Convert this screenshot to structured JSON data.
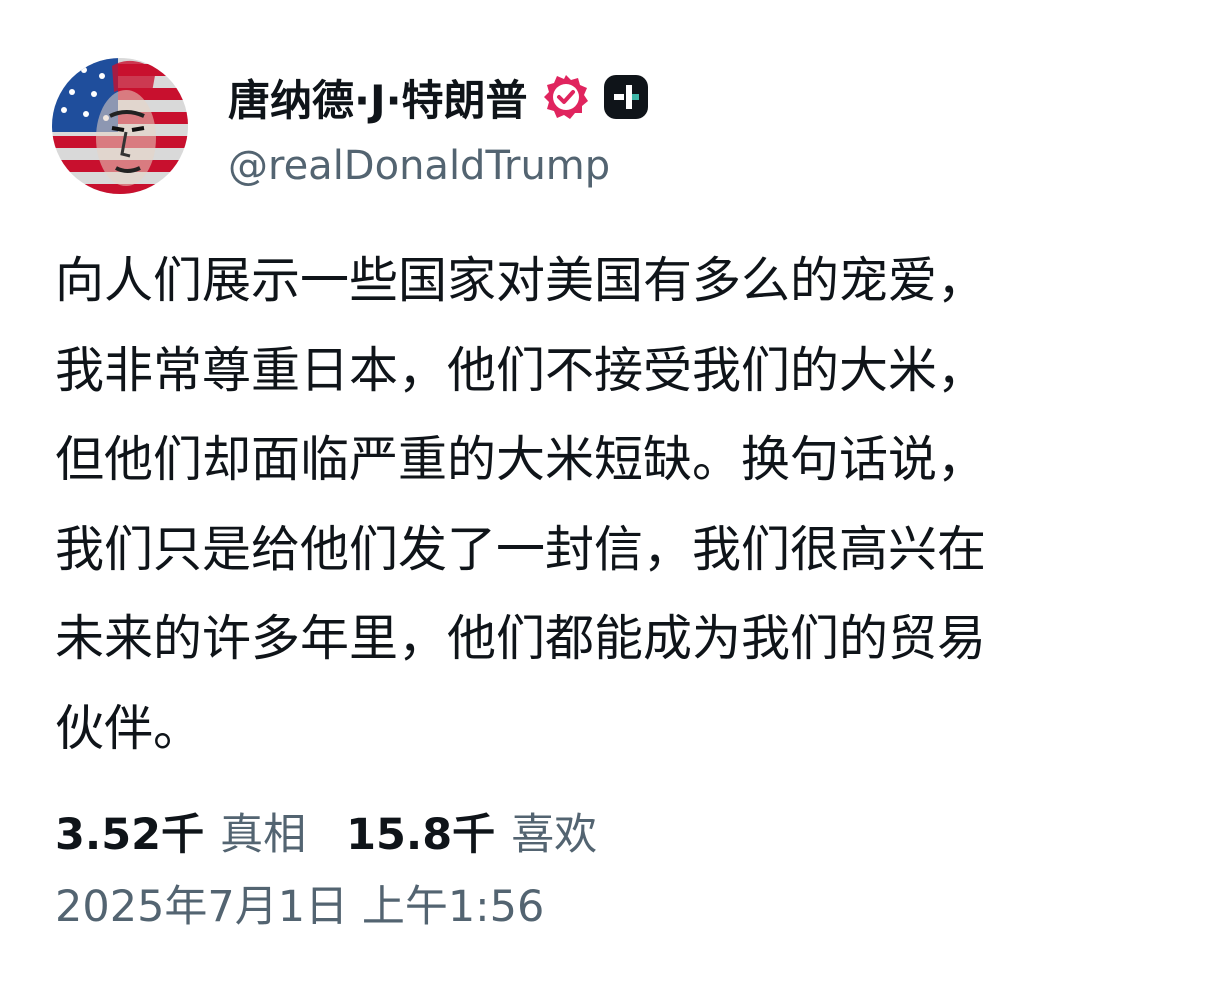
{
  "author": {
    "display_name": "唐纳德·J·特朗普",
    "handle": "@realDonaldTrump",
    "badge_color": "#e0245e",
    "app_badge_color": "#0f1419"
  },
  "post": {
    "lines": [
      "向人们展示一些国家对美国有多么的宠爱，",
      "我非常尊重日本，他们不接受我们的大米，",
      "但他们却面临严重的大米短缺。换句话说，",
      "我们只是给他们发了一封信，我们很高兴在",
      "未来的许多年里，他们都能成为我们的贸易",
      "伙伴。"
    ]
  },
  "stats": {
    "truths_count": "3.52千",
    "truths_label": "真相",
    "likes_count": "15.8千",
    "likes_label": "喜欢"
  },
  "timestamp": "2025年7月1日 上午1:56"
}
